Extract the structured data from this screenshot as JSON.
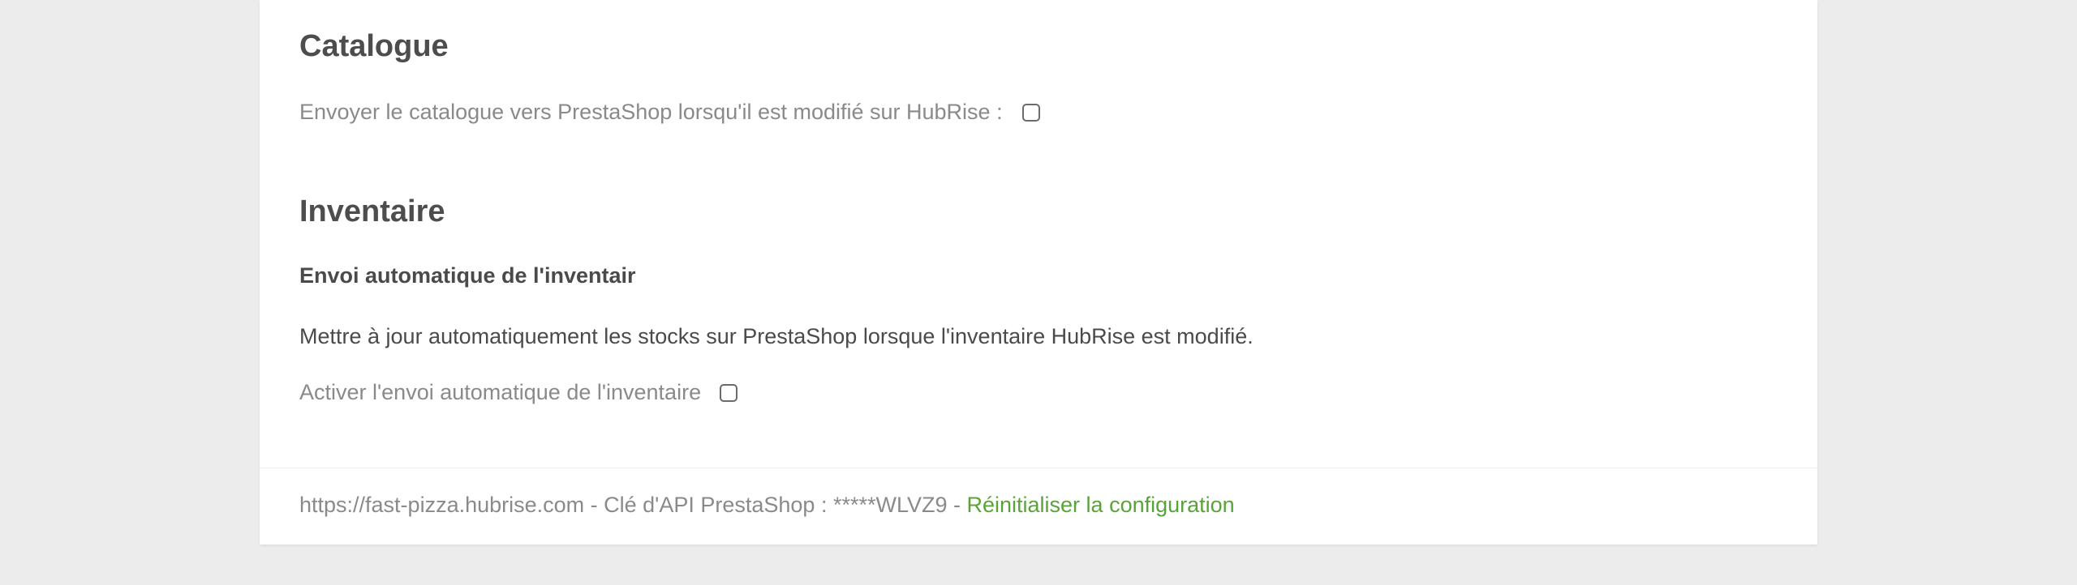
{
  "catalogue": {
    "title": "Catalogue",
    "send_label": "Envoyer le catalogue vers PrestaShop lorsqu'il est modifié sur HubRise :",
    "send_checked": false
  },
  "inventory": {
    "title": "Inventaire",
    "subtitle": "Envoi automatique de l'inventair",
    "description": "Mettre à jour automatiquement les stocks sur PrestaShop lorsque l'inventaire HubRise est modifié.",
    "activate_label": "Activer l'envoi automatique de l'inventaire",
    "activate_checked": false
  },
  "footer": {
    "info": "https://fast-pizza.hubrise.com - Clé d'API PrestaShop : *****WLVZ9 - ",
    "reset_link": "Réinitialiser la configuration"
  },
  "colors": {
    "background": "#ececec",
    "card": "#ffffff",
    "link": "#5aa33a"
  }
}
